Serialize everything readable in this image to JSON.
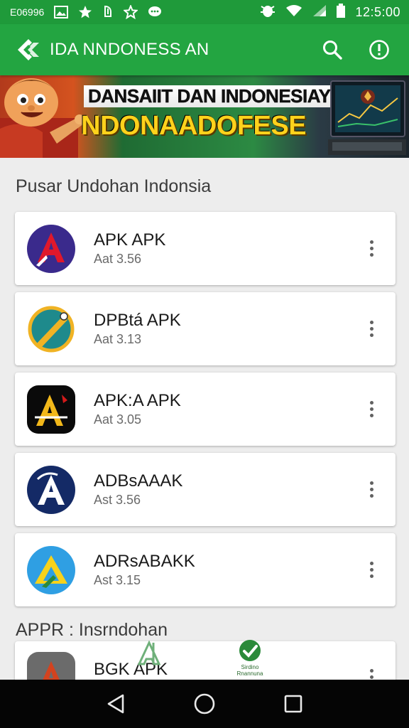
{
  "status_bar": {
    "left_text": "E06996",
    "time": "12:5:00",
    "icons": [
      "image-icon",
      "star-icon",
      "notification-icon",
      "star-outline-icon",
      "message-icon",
      "bug-icon",
      "wifi-icon",
      "signal-icon",
      "battery-icon"
    ]
  },
  "app_bar": {
    "title": "IDA NNDONESS AN",
    "logo_icon": "app-logo-icon",
    "actions": [
      "search-icon",
      "info-icon"
    ]
  },
  "banner": {
    "line1": "DANSAIIT DAN INDONESIAY",
    "line2": "NDONAADOFESE"
  },
  "sections": [
    {
      "title": "Pusar Undohan Indonsia",
      "items": [
        {
          "title": "APK APK",
          "subtitle": "Aat 3.56",
          "icon": "apk-red-a-icon",
          "icon_bg": "#3a2a8c",
          "icon_fg": "#e0182b"
        },
        {
          "title": "DPBtá APK",
          "subtitle": "Aat 3.13",
          "icon": "apk-teal-pencil-icon",
          "icon_bg": "#ffffff",
          "icon_fg": "#1e8a8c"
        },
        {
          "title": "APK:A APK",
          "subtitle": "Aat 3.05",
          "icon": "apk-black-a-icon",
          "icon_bg": "#0a0a0a",
          "icon_fg": "#f2b81a"
        },
        {
          "title": "ADBsAAAK",
          "subtitle": "Ast 3.56",
          "icon": "apk-navy-a-icon",
          "icon_bg": "#142a66",
          "icon_fg": "#ffffff"
        },
        {
          "title": "ADRsABAKK",
          "subtitle": "Ast 3.15",
          "icon": "apk-blue-triangle-icon",
          "icon_bg": "#2f9fe3",
          "icon_fg": "#f7d21b"
        }
      ]
    },
    {
      "title": "APPR : Insrndohan",
      "items": [
        {
          "title": "BGK APK",
          "subtitle": "",
          "icon": "apk-gray-a-icon",
          "icon_bg": "#6b6b6b",
          "icon_fg": "#d3431f"
        }
      ]
    }
  ],
  "overlay_badge_text": "Sirdino Rnannuna",
  "nav_bar": {
    "buttons": [
      "back-icon",
      "home-icon",
      "recents-icon"
    ]
  },
  "colors": {
    "primary": "#23a541",
    "primary_dark": "#1f9a3a",
    "background": "#ededed",
    "nav_bar": "#050505"
  }
}
